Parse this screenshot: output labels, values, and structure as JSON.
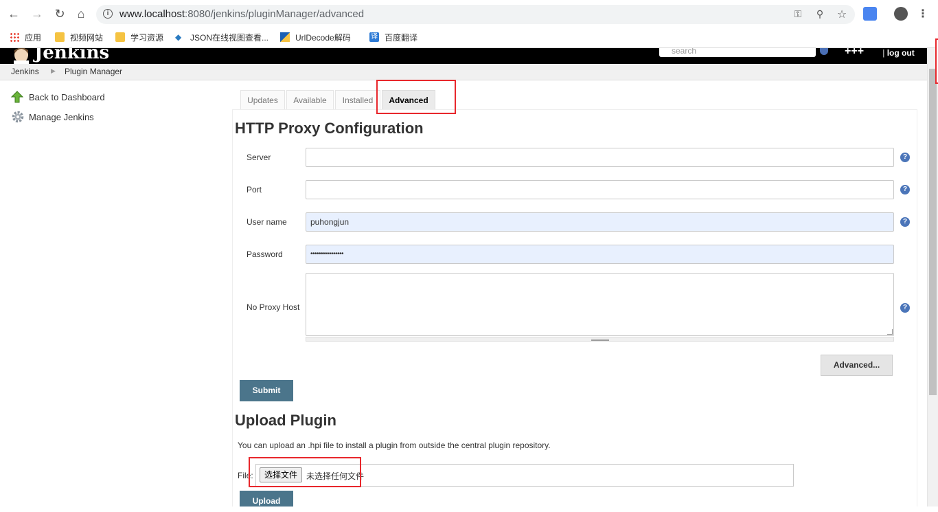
{
  "browser": {
    "url_host": "www.localhost",
    "url_path": ":8080/jenkins/pluginManager/advanced",
    "bookmarks": [
      {
        "label": "应用",
        "icon": "apps-grid-icon"
      },
      {
        "label": "视频网站",
        "icon": "folder-icon"
      },
      {
        "label": "学习资源",
        "icon": "folder-icon"
      },
      {
        "label": "JSON在线视图查看...",
        "icon": "json-icon"
      },
      {
        "label": "UrlDecode解码",
        "icon": "urldecode-icon"
      },
      {
        "label": "百度翻译",
        "icon": "translate-icon"
      }
    ]
  },
  "header": {
    "logo": "Jenkins",
    "search_placeholder": "search",
    "user": "+++",
    "logout": "log out"
  },
  "breadcrumb": [
    "Jenkins",
    "Plugin Manager"
  ],
  "sidebar": {
    "items": [
      {
        "label": "Back to Dashboard",
        "icon": "up-arrow-icon"
      },
      {
        "label": "Manage Jenkins",
        "icon": "gear-icon"
      }
    ]
  },
  "tabs": [
    {
      "label": "Updates"
    },
    {
      "label": "Available"
    },
    {
      "label": "Installed"
    },
    {
      "label": "Advanced"
    }
  ],
  "proxy": {
    "title": "HTTP Proxy Configuration",
    "fields": [
      {
        "label": "Server",
        "value": ""
      },
      {
        "label": "Port",
        "value": ""
      },
      {
        "label": "User name",
        "value": "puhongjun"
      },
      {
        "label": "Password",
        "value": "••••••••••••••••"
      },
      {
        "label": "No Proxy Host",
        "value": ""
      }
    ],
    "advanced_label": "Advanced...",
    "submit_label": "Submit"
  },
  "upload": {
    "title": "Upload Plugin",
    "description": "You can upload an .hpi file to install a plugin from outside the central plugin repository.",
    "file_label": "File:",
    "choose_label": "选择文件",
    "no_file_label": "未选择任何文件",
    "upload_label": "Upload"
  },
  "colors": {
    "accent_red": "#e8272c",
    "primary_button": "#4b758b",
    "help_icon": "#4b75b9"
  }
}
